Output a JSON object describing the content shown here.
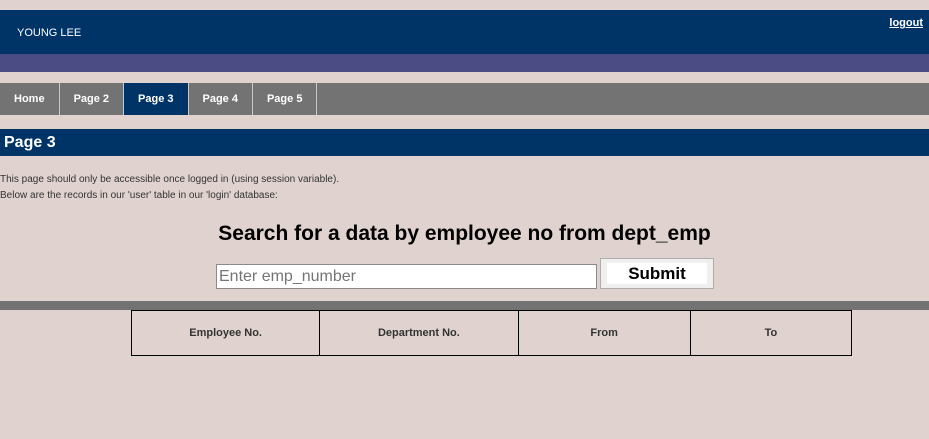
{
  "header": {
    "user_name": "YOUNG LEE",
    "logout_label": "logout"
  },
  "nav": {
    "items": [
      {
        "label": "Home",
        "active": false
      },
      {
        "label": "Page 2",
        "active": false
      },
      {
        "label": "Page 3",
        "active": true
      },
      {
        "label": "Page 4",
        "active": false
      },
      {
        "label": "Page 5",
        "active": false
      }
    ]
  },
  "page": {
    "title": "Page 3",
    "description_line1": "This page should only be accessible once logged in (using session variable).",
    "description_line2": "Below are the records in our 'user' table in our 'login' database:"
  },
  "search": {
    "heading": "Search for a data by employee no from dept_emp",
    "input_value": "",
    "placeholder": "Enter emp_number",
    "submit_label": "Submit"
  },
  "table": {
    "columns": [
      "Employee No.",
      "Department No.",
      "From",
      "To"
    ],
    "rows": []
  },
  "colors": {
    "background": "#e0d3cf",
    "header": "#003366",
    "subbar": "#4c4c84",
    "nav": "#737373",
    "nav_active": "#003366"
  }
}
